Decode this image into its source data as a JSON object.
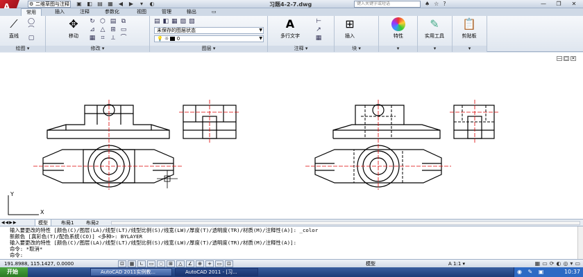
{
  "app": {
    "logo_letter": "A",
    "workspace": "二维草图与注释",
    "document_title": "习题4-2-7.dwg",
    "search_placeholder": "键入关键字或短语"
  },
  "quick_access": [
    "▣",
    "◧",
    "▤",
    "▦",
    "◀",
    "▶",
    "▾",
    "◐"
  ],
  "title_icons": [
    "♠",
    "☆",
    "?"
  ],
  "window_controls": [
    "—",
    "❐",
    "✕"
  ],
  "tabs": [
    "常用",
    "插入",
    "注释",
    "参数化",
    "视图",
    "管理",
    "输出",
    "▭"
  ],
  "ribbon": {
    "draw_panel": {
      "title": "绘图 ▾",
      "big_label": "直线",
      "small": [
        "◯",
        "⌒",
        "▢"
      ]
    },
    "modify_panel": {
      "title": "修改 ▾",
      "big_label": "移动",
      "small": [
        "↻",
        "⬡",
        "▤",
        "⧉",
        "⊿",
        "△",
        "⊞",
        "▭",
        "▦",
        "⌗",
        "⟂",
        "⌒"
      ]
    },
    "layers_panel": {
      "title": "图层 ▾",
      "layer_state": "未保存的图层状态",
      "layer_name": "0"
    },
    "annotation_panel": {
      "title": "注释 ▾",
      "text_label": "多行文字",
      "small": [
        "⊢",
        "↗",
        "▦"
      ]
    },
    "block_panel": {
      "title": "块 ▾",
      "insert_label": "插入"
    },
    "properties_label": "特性",
    "utilities_label": "实用工具",
    "clipboard_label": "剪贴板"
  },
  "viewport_controls": [
    "—",
    "□",
    "✕"
  ],
  "ucs": {
    "y": "Y",
    "x": "X"
  },
  "layout_tabs": {
    "nav": "◀◀▶▶",
    "model": "模型",
    "layout1": "布局1",
    "layout2": "布局2"
  },
  "command_lines": [
    "输入要更改的特性 [颜色(C)/图层(LA)/线型(LT)/线型比例(S)/线宽(LW)/厚度(T)/透明度(TR)/材质(M)/注释性(A)]: _color",
    "新颜色 [真彩色(T)/配色系统(CO)] <多种>: BYLAYER",
    "输入要更改的特性 [颜色(C)/图层(LA)/线型(LT)/线型比例(S)/线宽(LW)/厚度(T)/透明度(TR)/材质(M)/注释性(A)]:",
    "命令: *取消*",
    "命令:"
  ],
  "status": {
    "coordinates": "191.8988, 115.1427, 0.0000",
    "snap_buttons": [
      "⊡",
      "▦",
      "∟",
      "▭",
      "◌",
      "⊞",
      "△",
      "∠",
      "⊕",
      "+",
      "▭",
      "⊡"
    ],
    "model": "模型",
    "scale": "A 1:1 ▾",
    "right_icons": [
      "▦",
      "▭",
      "⟳",
      "◐",
      "◎",
      "▾",
      "▭"
    ]
  },
  "taskbar": {
    "start": "开始",
    "tasks": [
      "AutoCAD 2011实例教...",
      "AutoCAD 2011 - [习..."
    ],
    "tray_icons": "◉ ✎ ▣",
    "clock": "10:37"
  }
}
